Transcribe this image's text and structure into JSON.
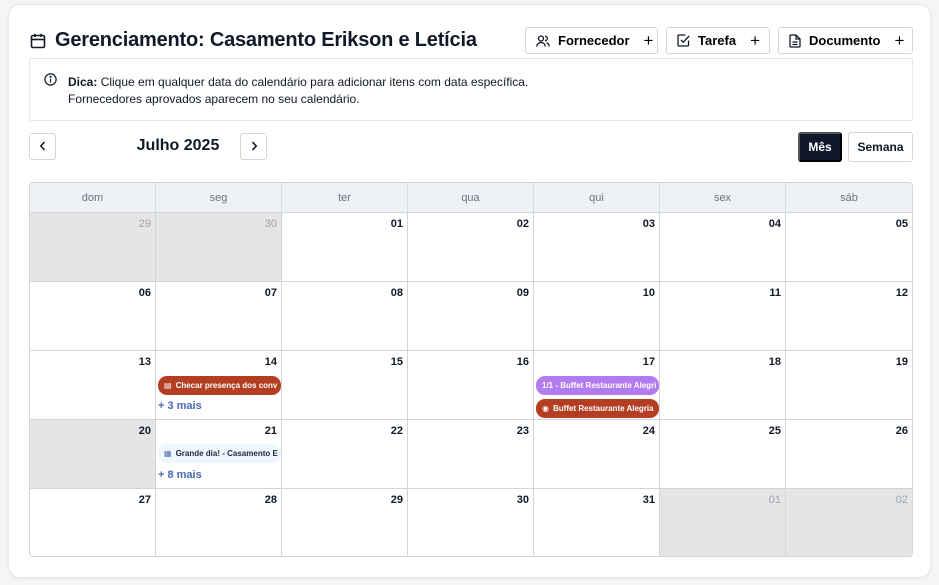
{
  "header": {
    "title": "Gerenciamento: Casamento Erikson e Letícia",
    "buttons": [
      {
        "label": "Fornecedor",
        "icon": "users-icon"
      },
      {
        "label": "Tarefa",
        "icon": "check-square-icon"
      },
      {
        "label": "Documento",
        "icon": "document-icon"
      }
    ],
    "plus": "+"
  },
  "tip": {
    "label": "Dica:",
    "line1": "Clique em qualquer data do calendário para adicionar itens com data específica.",
    "line2": "Fornecedores aprovados aparecem no seu calendário."
  },
  "nav": {
    "prev": "‹",
    "next": "›",
    "month": "Julho 2025",
    "views": [
      "Mês",
      "Semana"
    ],
    "active_view": "Mês"
  },
  "calendar": {
    "weekdays": [
      "dom",
      "seg",
      "ter",
      "qua",
      "qui",
      "sex",
      "sáb"
    ],
    "days": [
      "29",
      "30",
      "01",
      "02",
      "03",
      "04",
      "05",
      "06",
      "07",
      "08",
      "09",
      "10",
      "11",
      "12",
      "13",
      "14",
      "15",
      "16",
      "17",
      "18",
      "19",
      "20",
      "21",
      "22",
      "23",
      "24",
      "25",
      "26",
      "27",
      "28",
      "29",
      "30",
      "31",
      "01",
      "02"
    ],
    "events": {
      "e1": {
        "label": "Checar presença dos conv",
        "icon": "▤",
        "color": "#b33e21"
      },
      "e1_more": "+ 3 mais",
      "e2": {
        "label": "1/1 - Buffet Restaurante Alegri",
        "color": "#b27cf0"
      },
      "e3": {
        "label": "Buffet Restaurante Alegria",
        "icon": "◉",
        "color": "#b33e21"
      },
      "e4": {
        "label": "Grande dia! - Casamento E",
        "icon": "▦"
      },
      "e4_more": "+ 8 mais"
    }
  }
}
